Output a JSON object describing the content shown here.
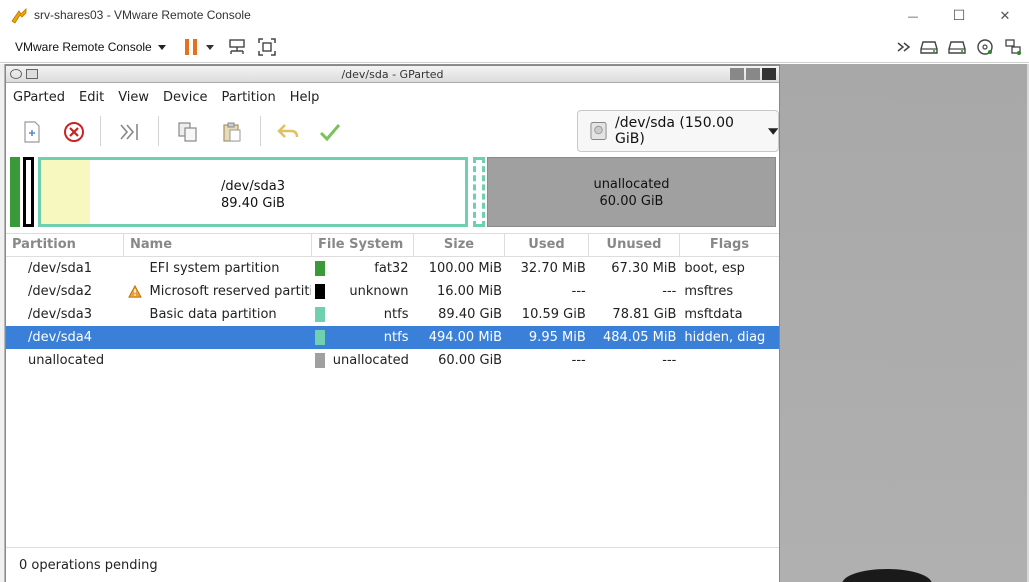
{
  "vm": {
    "window_title": "srv-shares03 - VMware Remote Console",
    "menu_label": "VMware Remote Console",
    "window_controls": {
      "minimize": "—",
      "maximize": "☐",
      "close": "✕"
    }
  },
  "gparted": {
    "window_title": "/dev/sda - GParted",
    "menu": [
      "GParted",
      "Edit",
      "View",
      "Device",
      "Partition",
      "Help"
    ],
    "device_selector": "/dev/sda (150.00 GiB)",
    "disk_map": {
      "sda3": {
        "label": "/dev/sda3",
        "size": "89.40 GiB"
      },
      "unallocated": {
        "label": "unallocated",
        "size": "60.00 GiB"
      }
    },
    "columns": [
      "Partition",
      "Name",
      "File System",
      "Size",
      "Used",
      "Unused",
      "Flags"
    ],
    "rows": [
      {
        "partition": "/dev/sda1",
        "name": "EFI system partition",
        "warn": false,
        "color": "#3a9a3a",
        "fs": "fat32",
        "size": "100.00 MiB",
        "used": "32.70 MiB",
        "unused": "67.30 MiB",
        "flags": "boot, esp",
        "selected": false
      },
      {
        "partition": "/dev/sda2",
        "name": "Microsoft reserved partition",
        "warn": true,
        "color": "#000000",
        "fs": "unknown",
        "size": "16.00 MiB",
        "used": "---",
        "unused": "---",
        "flags": "msftres",
        "selected": false
      },
      {
        "partition": "/dev/sda3",
        "name": "Basic data partition",
        "warn": false,
        "color": "#6fd0b0",
        "fs": "ntfs",
        "size": "89.40 GiB",
        "used": "10.59 GiB",
        "unused": "78.81 GiB",
        "flags": "msftdata",
        "selected": false
      },
      {
        "partition": "/dev/sda4",
        "name": "",
        "warn": false,
        "color": "#6fd0b0",
        "fs": "ntfs",
        "size": "494.00 MiB",
        "used": "9.95 MiB",
        "unused": "484.05 MiB",
        "flags": "hidden, diag",
        "selected": true
      },
      {
        "partition": "unallocated",
        "name": "",
        "warn": false,
        "color": "#a0a0a0",
        "fs": "unallocated",
        "size": "60.00 GiB",
        "used": "---",
        "unused": "---",
        "flags": "",
        "selected": false
      }
    ],
    "status": "0 operations pending"
  },
  "colors": {
    "selection": "#3a80d8",
    "ntfs": "#6fd0b0",
    "fat32": "#3a9a3a",
    "unallocated": "#a0a0a0",
    "pause_orange": "#e8701a"
  }
}
